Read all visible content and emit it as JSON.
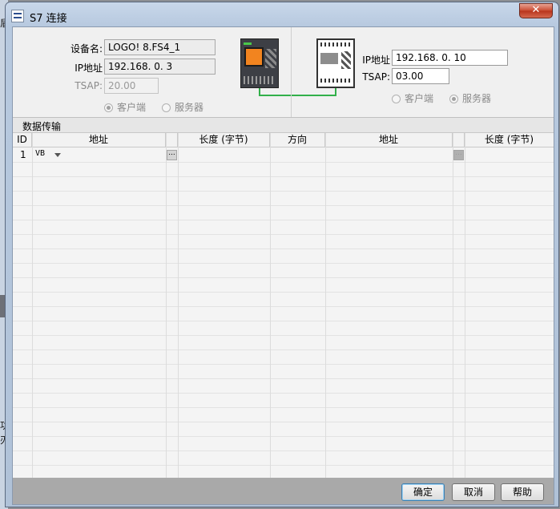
{
  "background": {
    "left_fragments": [
      "盾",
      "功",
      "刃"
    ]
  },
  "window": {
    "title": "S7 连接",
    "close_glyph": "✕"
  },
  "local": {
    "device_name_label": "设备名:",
    "device_name_value": "LOGO! 8.FS4_1",
    "ip_label": "IP地址",
    "ip_value": "192.168.  0.  3",
    "tsap_label": "TSAP:",
    "tsap_value": "20.00",
    "radio_client": "客户端",
    "radio_server": "服务器",
    "selected_role": "客户端"
  },
  "remote": {
    "ip_label": "IP地址",
    "ip_value": "192.168.  0. 10",
    "tsap_label": "TSAP:",
    "tsap_value": "03.00",
    "radio_client": "客户端",
    "radio_server": "服务器",
    "selected_role": "服务器"
  },
  "data_transfer": {
    "title": "数据传输",
    "columns": [
      "ID",
      "地址",
      "长度 (字节)",
      "方向",
      "地址",
      "长度 (字节)"
    ],
    "rows": [
      {
        "id": "1",
        "local_address": "VB",
        "local_length": "",
        "direction": "",
        "remote_address": "",
        "remote_length": ""
      }
    ],
    "ellipsis": "..."
  },
  "buttons": {
    "ok": "确定",
    "cancel": "取消",
    "help": "帮助"
  },
  "colors": {
    "logo_screen": "#f2841f",
    "link_line": "#32b04a",
    "footer": "#a9a9a9"
  }
}
